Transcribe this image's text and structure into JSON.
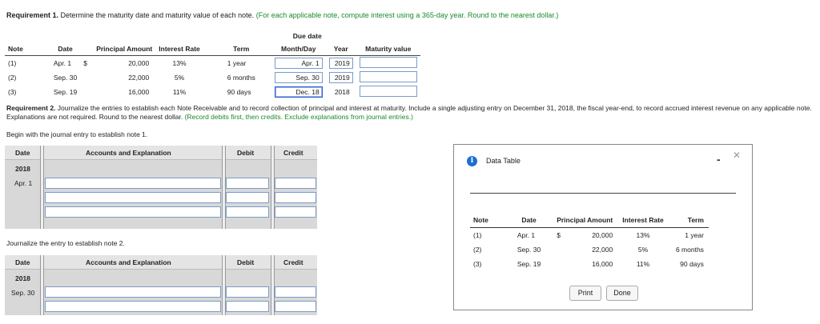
{
  "req1": {
    "title": "Requirement 1.",
    "text": "Determine the maturity date and maturity value of each note.",
    "hint": "(For each applicable note, compute interest using a 365-day year. Round to the nearest dollar.)"
  },
  "notes_table": {
    "group_header": "Due date",
    "headers": [
      "Note",
      "Date",
      "Principal Amount",
      "Interest Rate",
      "Term",
      "Month/Day",
      "Year",
      "Maturity value"
    ],
    "rows": [
      {
        "note": "(1)",
        "date": "Apr. 1",
        "dollar": "$",
        "principal": "20,000",
        "rate": "13%",
        "term": "1 year",
        "monthday": "Apr. 1",
        "year": "2019",
        "maturity": ""
      },
      {
        "note": "(2)",
        "date": "Sep. 30",
        "dollar": "",
        "principal": "22,000",
        "rate": "5%",
        "term": "6 months",
        "monthday": "Sep. 30",
        "year": "2019",
        "maturity": ""
      },
      {
        "note": "(3)",
        "date": "Sep. 19",
        "dollar": "",
        "principal": "16,000",
        "rate": "11%",
        "term": "90 days",
        "monthday": "Dec. 18",
        "year": "2018",
        "maturity": ""
      }
    ]
  },
  "req2": {
    "title": "Requirement 2.",
    "text": "Journalize the entries to establish each Note Receivable and to record collection of principal and interest at maturity. Include a single adjusting entry on December 31, 2018, the fiscal year-end, to record accrued interest revenue on any applicable note. Explanations are not required. Round to the nearest dollar.",
    "hint": "(Record debits first, then credits. Exclude explanations from journal entries.)"
  },
  "begin_text": "Begin with the journal entry to establish note 1.",
  "journal1": {
    "headers": [
      "Date",
      "Accounts and Explanation",
      "Debit",
      "Credit"
    ],
    "year": "2018",
    "date": "Apr. 1"
  },
  "journal2_intro": "Journalize the entry to establish note 2.",
  "journal2": {
    "headers": [
      "Date",
      "Accounts and Explanation",
      "Debit",
      "Credit"
    ],
    "year": "2018",
    "date": "Sep. 30"
  },
  "dialog": {
    "title": "Data Table",
    "info_glyph": "i",
    "minimize_glyph": "-",
    "close_glyph": "✕",
    "headers": [
      "Note",
      "Date",
      "Principal Amount",
      "Interest Rate",
      "Term"
    ],
    "rows": [
      {
        "note": "(1)",
        "date": "Apr. 1",
        "dollar": "$",
        "principal": "20,000",
        "rate": "13%",
        "term": "1 year"
      },
      {
        "note": "(2)",
        "date": "Sep. 30",
        "dollar": "",
        "principal": "22,000",
        "rate": "5%",
        "term": "6 months"
      },
      {
        "note": "(3)",
        "date": "Sep. 19",
        "dollar": "",
        "principal": "16,000",
        "rate": "11%",
        "term": "90 days"
      }
    ],
    "print_label": "Print",
    "done_label": "Done"
  }
}
